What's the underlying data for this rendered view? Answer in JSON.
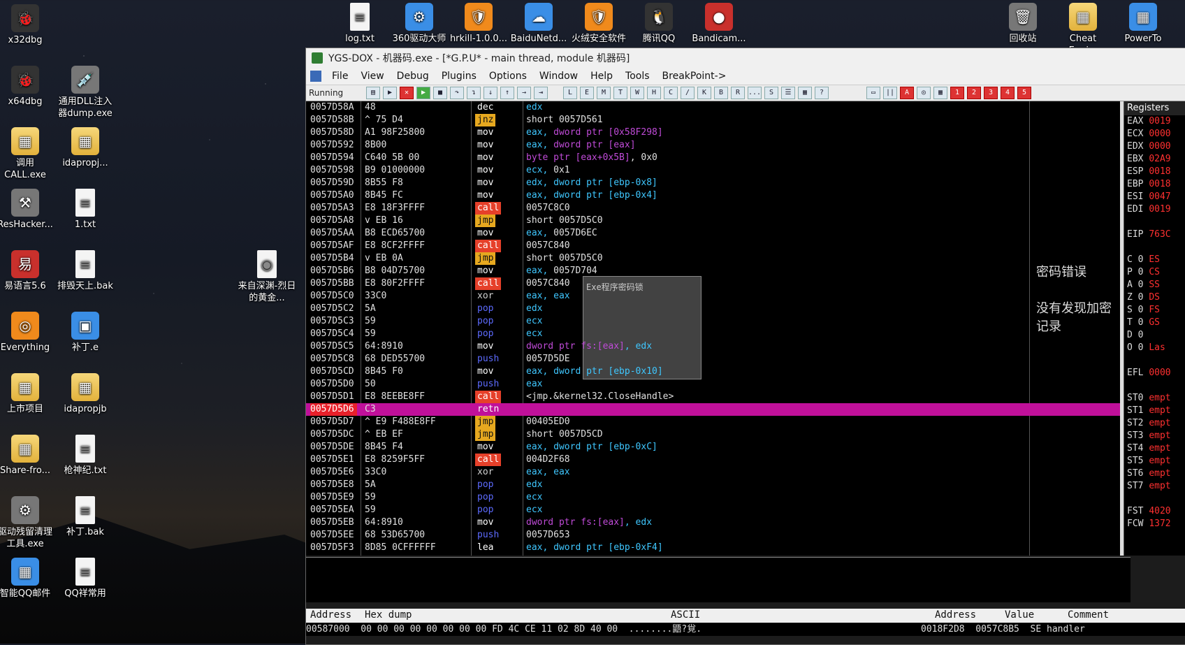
{
  "desktop_left": [
    {
      "label": "x32dbg",
      "glyph": "🐞",
      "cls": "g-dark"
    },
    {
      "label": "x64dbg",
      "glyph": "🐞",
      "cls": "g-dark"
    },
    {
      "label": "通用DLL注入器dump.exe",
      "glyph": "💉",
      "cls": "g-gray"
    },
    {
      "label": "调用CALL.exe",
      "glyph": "▦",
      "cls": "g-folder"
    },
    {
      "label": "idapropj...",
      "glyph": "▦",
      "cls": "g-folder"
    },
    {
      "label": "ResHacker...",
      "glyph": "⚒",
      "cls": "g-gray"
    },
    {
      "label": "1.txt",
      "glyph": "≡",
      "cls": "g-file"
    },
    {
      "label": "易语言5.6",
      "glyph": "易",
      "cls": "g-red"
    },
    {
      "label": "排毁天上.bak",
      "glyph": "≡",
      "cls": "g-file"
    },
    {
      "label": "来自深渊-烈日的黄金...",
      "glyph": "◉",
      "cls": "g-file"
    },
    {
      "label": "Everything",
      "glyph": "◎",
      "cls": "g-orange"
    },
    {
      "label": "补丁.e",
      "glyph": "▣",
      "cls": "g-blue"
    },
    {
      "label": "上市项目",
      "glyph": "▦",
      "cls": "g-folder"
    },
    {
      "label": "idapropjb",
      "glyph": "▦",
      "cls": "g-folder"
    },
    {
      "label": "Share-fro...",
      "glyph": "▦",
      "cls": "g-folder"
    },
    {
      "label": "枪神纪.txt",
      "glyph": "≡",
      "cls": "g-file"
    },
    {
      "label": "驱动残留清理工具.exe",
      "glyph": "⚙",
      "cls": "g-gray"
    },
    {
      "label": "补丁.bak",
      "glyph": "≡",
      "cls": "g-file"
    },
    {
      "label": "智能QQ邮件",
      "glyph": "▦",
      "cls": "g-blue"
    },
    {
      "label": "QQ祥常用",
      "glyph": "≡",
      "cls": "g-file"
    }
  ],
  "desktop_top": [
    {
      "label": "log.txt",
      "glyph": "≡",
      "cls": "g-file"
    },
    {
      "label": "360驱动大师",
      "glyph": "⚙",
      "cls": "g-blue"
    },
    {
      "label": "hrkill-1.0.0...",
      "glyph": "🛡",
      "cls": "g-orange"
    },
    {
      "label": "BaiduNetd...",
      "glyph": "☁",
      "cls": "g-blue"
    },
    {
      "label": "火绒安全软件",
      "glyph": "🛡",
      "cls": "g-orange"
    },
    {
      "label": "腾讯QQ",
      "glyph": "🐧",
      "cls": "g-dark"
    },
    {
      "label": "Bandicam...",
      "glyph": "●",
      "cls": "g-red"
    },
    {
      "label": "回收站",
      "glyph": "🗑",
      "cls": "g-gray"
    },
    {
      "label": "Cheat Engi...",
      "glyph": "▦",
      "cls": "g-folder"
    },
    {
      "label": "PowerTo",
      "glyph": "▦",
      "cls": "g-blue"
    }
  ],
  "window": {
    "title": "YGS-DOX - 机器码.exe - [*G.P.U* - main thread, module 机器码]",
    "menu": [
      "File",
      "View",
      "Debug",
      "Plugins",
      "Options",
      "Window",
      "Help",
      "Tools",
      "BreakPoint->"
    ],
    "status": "Running",
    "toolbar_left": [
      "▤",
      "▶",
      "✕",
      "▶",
      "■",
      "↷",
      "↴",
      "↓",
      "↑",
      "→",
      "⇥"
    ],
    "toolbar_letters": [
      "L",
      "E",
      "M",
      "T",
      "W",
      "H",
      "C",
      "/",
      "K",
      "B",
      "R",
      "...",
      "S",
      "☰",
      "▦",
      "?"
    ],
    "toolbar_right": [
      "▭",
      "||",
      "A",
      "◎",
      "▦",
      "1",
      "2",
      "3",
      "4",
      "5"
    ],
    "registers_title": "Registers",
    "registers": [
      {
        "n": "EAX",
        "v": "0019"
      },
      {
        "n": "ECX",
        "v": "0000"
      },
      {
        "n": "EDX",
        "v": "0000"
      },
      {
        "n": "EBX",
        "v": "02A9"
      },
      {
        "n": "ESP",
        "v": "0018"
      },
      {
        "n": "EBP",
        "v": "0018"
      },
      {
        "n": "ESI",
        "v": "0047"
      },
      {
        "n": "EDI",
        "v": "0019"
      },
      {
        "n": "",
        "v": ""
      },
      {
        "n": "EIP",
        "v": "763C"
      },
      {
        "n": "",
        "v": ""
      },
      {
        "n": "C 0",
        "v": "ES"
      },
      {
        "n": "P 0",
        "v": "CS"
      },
      {
        "n": "A 0",
        "v": "SS"
      },
      {
        "n": "Z 0",
        "v": "DS"
      },
      {
        "n": "S 0",
        "v": "FS"
      },
      {
        "n": "T 0",
        "v": "GS"
      },
      {
        "n": "D 0",
        "v": ""
      },
      {
        "n": "O 0",
        "v": "Las"
      },
      {
        "n": "",
        "v": ""
      },
      {
        "n": "EFL",
        "v": "0000"
      },
      {
        "n": "",
        "v": ""
      },
      {
        "n": "ST0",
        "v": "empt"
      },
      {
        "n": "ST1",
        "v": "empt"
      },
      {
        "n": "ST2",
        "v": "empt"
      },
      {
        "n": "ST3",
        "v": "empt"
      },
      {
        "n": "ST4",
        "v": "empt"
      },
      {
        "n": "ST5",
        "v": "empt"
      },
      {
        "n": "ST6",
        "v": "empt"
      },
      {
        "n": "ST7",
        "v": "empt"
      },
      {
        "n": "",
        "v": ""
      },
      {
        "n": "FST",
        "v": "4020"
      },
      {
        "n": "FCW",
        "v": "1372"
      }
    ],
    "comments": [
      "密码错误",
      "没有发现加密记录"
    ],
    "dialog_title": "Exe程序密码锁",
    "dump_header": {
      "address": "Address",
      "hex": "Hex dump",
      "ascii": "ASCII"
    },
    "dump_row": "00587000  00 00 00 00 00 00 00 00 FD 4C CE 11 02 8D 40 00  ........鼯?覍.",
    "stack_header": {
      "address": "Address",
      "value": "Value",
      "comment": "Comment"
    },
    "stack_row": "0018F2D8  0057C8B5  SE handler"
  },
  "disasm": [
    {
      "a": "0057D58A",
      "h": "48",
      "m": "dec",
      "t": "dec",
      "o": [
        [
          "reg",
          "edx"
        ]
      ]
    },
    {
      "a": "0057D58B",
      "h": "^ 75 D4",
      "m": "jnz",
      "t": "jmp",
      "o": [
        [
          "num",
          "short 0057D561"
        ]
      ]
    },
    {
      "a": "0057D58D",
      "h": "A1 98F25800",
      "m": "mov",
      "t": "mov",
      "o": [
        [
          "reg",
          "eax, "
        ],
        [
          "kw",
          "dword ptr [0x58F298]"
        ]
      ]
    },
    {
      "a": "0057D592",
      "h": "8B00",
      "m": "mov",
      "t": "mov",
      "o": [
        [
          "reg",
          "eax, "
        ],
        [
          "kw",
          "dword ptr [eax]"
        ]
      ]
    },
    {
      "a": "0057D594",
      "h": "C640 5B 00",
      "m": "mov",
      "t": "mov",
      "o": [
        [
          "kw",
          "byte ptr [eax+0x5B]"
        ],
        [
          "num",
          ", 0x0"
        ]
      ]
    },
    {
      "a": "0057D598",
      "h": "B9 01000000",
      "m": "mov",
      "t": "mov",
      "o": [
        [
          "reg",
          "ecx, "
        ],
        [
          "num",
          "0x1"
        ]
      ]
    },
    {
      "a": "0057D59D",
      "h": "8B55 F8",
      "m": "mov",
      "t": "mov",
      "o": [
        [
          "reg",
          "edx, "
        ],
        [
          "reg",
          "dword ptr [ebp-0x8]"
        ]
      ]
    },
    {
      "a": "0057D5A0",
      "h": "8B45 FC",
      "m": "mov",
      "t": "mov",
      "o": [
        [
          "reg",
          "eax, "
        ],
        [
          "reg",
          "dword ptr [ebp-0x4]"
        ]
      ]
    },
    {
      "a": "0057D5A3",
      "h": "E8 18F3FFFF",
      "m": "call",
      "t": "call",
      "o": [
        [
          "num",
          "0057C8C0"
        ]
      ]
    },
    {
      "a": "0057D5A8",
      "h": "v EB 16",
      "m": "jmp",
      "t": "jmp",
      "o": [
        [
          "num",
          "short 0057D5C0"
        ]
      ]
    },
    {
      "a": "0057D5AA",
      "h": "B8 ECD65700",
      "m": "mov",
      "t": "mov",
      "o": [
        [
          "reg",
          "eax, "
        ],
        [
          "num",
          "0057D6EC"
        ]
      ]
    },
    {
      "a": "0057D5AF",
      "h": "E8 8CF2FFFF",
      "m": "call",
      "t": "call",
      "o": [
        [
          "num",
          "0057C840"
        ]
      ]
    },
    {
      "a": "0057D5B4",
      "h": "v EB 0A",
      "m": "jmp",
      "t": "jmp",
      "o": [
        [
          "num",
          "short 0057D5C0"
        ]
      ]
    },
    {
      "a": "0057D5B6",
      "h": "B8 04D75700",
      "m": "mov",
      "t": "mov",
      "o": [
        [
          "reg",
          "eax, "
        ],
        [
          "num",
          "0057D704"
        ]
      ]
    },
    {
      "a": "0057D5BB",
      "h": "E8 80F2FFFF",
      "m": "call",
      "t": "call",
      "o": [
        [
          "num",
          "0057C840"
        ]
      ]
    },
    {
      "a": "0057D5C0",
      "h": "33C0",
      "m": "xor",
      "t": "xor",
      "o": [
        [
          "reg",
          "eax, eax"
        ]
      ]
    },
    {
      "a": "0057D5C2",
      "h": "5A",
      "m": "pop",
      "t": "push",
      "o": [
        [
          "reg",
          "edx"
        ]
      ]
    },
    {
      "a": "0057D5C3",
      "h": "59",
      "m": "pop",
      "t": "push",
      "o": [
        [
          "reg",
          "ecx"
        ]
      ]
    },
    {
      "a": "0057D5C4",
      "h": "59",
      "m": "pop",
      "t": "push",
      "o": [
        [
          "reg",
          "ecx"
        ]
      ]
    },
    {
      "a": "0057D5C5",
      "h": "64:8910",
      "m": "mov",
      "t": "mov",
      "o": [
        [
          "kw",
          "dword ptr fs:[eax]"
        ],
        [
          "reg",
          ", edx"
        ]
      ]
    },
    {
      "a": "0057D5C8",
      "h": "68 DED55700",
      "m": "push",
      "t": "push",
      "o": [
        [
          "num",
          "0057D5DE"
        ]
      ]
    },
    {
      "a": "0057D5CD",
      "h": "8B45 F0",
      "m": "mov",
      "t": "mov",
      "o": [
        [
          "reg",
          "eax, "
        ],
        [
          "reg",
          "dword ptr [ebp-0x10]"
        ]
      ]
    },
    {
      "a": "0057D5D0",
      "h": "50",
      "m": "push",
      "t": "push",
      "o": [
        [
          "reg",
          "eax"
        ]
      ]
    },
    {
      "a": "0057D5D1",
      "h": "E8 8EEBE8FF",
      "m": "call",
      "t": "call",
      "o": [
        [
          "num",
          "<jmp.&kernel32.CloseHandle>"
        ]
      ]
    },
    {
      "a": "0057D5D6",
      "h": "C3",
      "m": "retn",
      "t": "retn",
      "o": [],
      "sel": true
    },
    {
      "a": "0057D5D7",
      "h": "^ E9 F488E8FF",
      "m": "jmp",
      "t": "jmp",
      "o": [
        [
          "num",
          "00405ED0"
        ]
      ]
    },
    {
      "a": "0057D5DC",
      "h": "^ EB EF",
      "m": "jmp",
      "t": "jmp",
      "o": [
        [
          "num",
          "short 0057D5CD"
        ]
      ]
    },
    {
      "a": "0057D5DE",
      "h": "8B45 F4",
      "m": "mov",
      "t": "mov",
      "o": [
        [
          "reg",
          "eax, "
        ],
        [
          "reg",
          "dword ptr [ebp-0xC]"
        ]
      ]
    },
    {
      "a": "0057D5E1",
      "h": "E8 8259F5FF",
      "m": "call",
      "t": "call",
      "o": [
        [
          "num",
          "004D2F68"
        ]
      ]
    },
    {
      "a": "0057D5E6",
      "h": "33C0",
      "m": "xor",
      "t": "xor",
      "o": [
        [
          "reg",
          "eax, eax"
        ]
      ]
    },
    {
      "a": "0057D5E8",
      "h": "5A",
      "m": "pop",
      "t": "push",
      "o": [
        [
          "reg",
          "edx"
        ]
      ]
    },
    {
      "a": "0057D5E9",
      "h": "59",
      "m": "pop",
      "t": "push",
      "o": [
        [
          "reg",
          "ecx"
        ]
      ]
    },
    {
      "a": "0057D5EA",
      "h": "59",
      "m": "pop",
      "t": "push",
      "o": [
        [
          "reg",
          "ecx"
        ]
      ]
    },
    {
      "a": "0057D5EB",
      "h": "64:8910",
      "m": "mov",
      "t": "mov",
      "o": [
        [
          "kw",
          "dword ptr fs:[eax]"
        ],
        [
          "reg",
          ", edx"
        ]
      ]
    },
    {
      "a": "0057D5EE",
      "h": "68 53D65700",
      "m": "push",
      "t": "push",
      "o": [
        [
          "num",
          "0057D653"
        ]
      ]
    },
    {
      "a": "0057D5F3",
      "h": "8D85 0CFFFFFF",
      "m": "lea",
      "t": "lea",
      "o": [
        [
          "reg",
          "eax, "
        ],
        [
          "reg",
          "dword ptr [ebp-0xF4]"
        ]
      ]
    }
  ]
}
